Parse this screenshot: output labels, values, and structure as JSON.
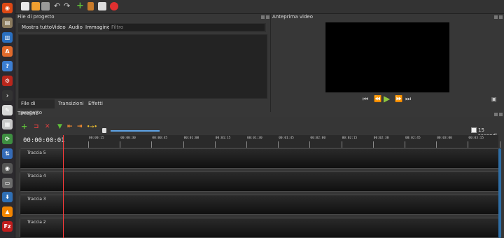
{
  "launcher": {
    "icons": [
      {
        "name": "ubuntu-dash-icon",
        "glyph": "◉",
        "color": "#dd4814"
      },
      {
        "name": "files-icon",
        "glyph": "▤",
        "color": "#8a7a5e"
      },
      {
        "name": "writer-document-icon",
        "glyph": "▥",
        "color": "#2a6fbf"
      },
      {
        "name": "software-center-icon",
        "glyph": "A",
        "color": "#e06a2c"
      },
      {
        "name": "help-icon",
        "glyph": "?",
        "color": "#3c7ed1"
      },
      {
        "name": "settings-icon",
        "glyph": "⚙",
        "color": "#b8261c"
      },
      {
        "name": "terminal-icon",
        "glyph": "›",
        "color": "#333333"
      },
      {
        "name": "text-editor-icon",
        "glyph": "✎",
        "color": "#d8d8d8"
      },
      {
        "name": "calculator-icon",
        "glyph": "▦",
        "color": "#c7c7c7"
      },
      {
        "name": "sync-icon",
        "glyph": "⟳",
        "color": "#3e8e41"
      },
      {
        "name": "network-icon",
        "glyph": "⇅",
        "color": "#356bb6"
      },
      {
        "name": "eye-icon",
        "glyph": "◉",
        "color": "#555555"
      },
      {
        "name": "monitor-icon",
        "glyph": "▭",
        "color": "#6c6c6c"
      },
      {
        "name": "download-icon",
        "glyph": "⬇",
        "color": "#2f6fb4"
      },
      {
        "name": "vlc-icon",
        "glyph": "▲",
        "color": "#f28500"
      },
      {
        "name": "filezilla-icon",
        "glyph": "Fz",
        "color": "#bf1c1c"
      }
    ]
  },
  "toolbar": {
    "buttons": [
      {
        "name": "new-project-icon",
        "color": "#e8e8e8"
      },
      {
        "name": "open-project-icon",
        "color": "#f0a030"
      },
      {
        "name": "save-project-icon",
        "color": "#9a9a9a"
      },
      {
        "name": "undo-icon",
        "color": "#bdbdbd"
      },
      {
        "name": "redo-icon",
        "color": "#bdbdbd"
      },
      {
        "name": "import-files-icon",
        "color": "#5fbf3a"
      },
      {
        "name": "choose-profile-icon",
        "color": "#c87b2a"
      },
      {
        "name": "fullscreen-icon",
        "color": "#dddddd"
      },
      {
        "name": "export-video-icon",
        "color": "#e03030"
      }
    ]
  },
  "project_files": {
    "title": "File di progetto",
    "tabs": [
      "Mostra tutto",
      "Video",
      "Audio",
      "Immagine"
    ],
    "filter_placeholder": "Filtro",
    "bottom_tabs": [
      "File di progetto",
      "Transizioni",
      "Effetti"
    ]
  },
  "preview": {
    "title": "Anteprima video"
  },
  "timeline": {
    "title": "Timeline",
    "timecode": "00:00:00:01",
    "zoom_label": "15 secondi",
    "ruler_labels": [
      "00:00:15",
      "00:00:30",
      "00:00:45",
      "00:01:00",
      "00:01:15",
      "00:01:30",
      "00:01:45",
      "00:02:00",
      "00:02:15",
      "00:02:30",
      "00:02:45",
      "00:03:00",
      "00:03:15"
    ],
    "tracks": [
      "Traccia 5",
      "Traccia 4",
      "Traccia 3",
      "Traccia 2"
    ]
  }
}
